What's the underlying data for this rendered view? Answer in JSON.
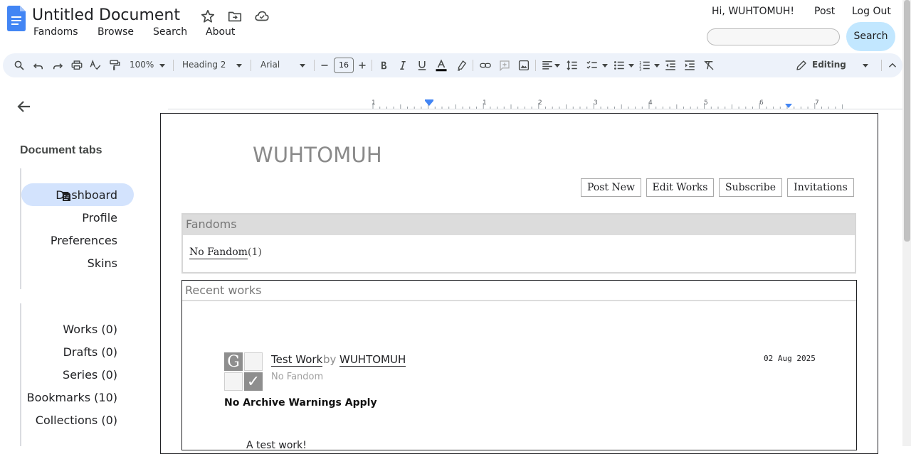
{
  "doc": {
    "title": "Untitled Document",
    "menu": [
      "Fandoms",
      "Browse",
      "Search",
      "About"
    ]
  },
  "site": {
    "greeting": "Hi, WUHTOMUH!",
    "post_link": "Post",
    "logout_link": "Log Out",
    "search_value": "",
    "search_button": "Search"
  },
  "toolbar": {
    "zoom": "100%",
    "style": "Heading 2",
    "font": "Arial",
    "font_size": "16",
    "mode": "Editing"
  },
  "ruler": {
    "numbers": [
      "1",
      "1",
      "2",
      "3",
      "4",
      "5",
      "6",
      "7"
    ]
  },
  "sidebar": {
    "heading": "Document tabs",
    "tabs": [
      "Dashboard",
      "Profile",
      "Preferences",
      "Skins"
    ],
    "sections": [
      "Works (0)",
      "Drafts (0)",
      "Series (0)",
      "Bookmarks (10)",
      "Collections (0)"
    ]
  },
  "page": {
    "username": "WUHTOMUH",
    "nav": [
      "Post New",
      "Edit Works",
      "Subscribe",
      "Invitations"
    ],
    "fandoms": {
      "title": "Fandoms",
      "link": "No Fandom",
      "count": "(1)"
    },
    "recent": {
      "title": "Recent works",
      "work": {
        "title": "Test Work",
        "by": "by",
        "author": "WUHTOMUH",
        "fandom": "No Fandom",
        "date": "02 Aug 2025",
        "warning": "No Archive Warnings Apply",
        "summary": "A test work!",
        "rating_symbol": "G",
        "complete_symbol": "✓"
      }
    }
  },
  "colors": {
    "accent": "#c2e7ff",
    "toolbar_bg": "#edf2fa",
    "active_tab": "#d3e3fd",
    "doc_blue": "#4285f4"
  }
}
